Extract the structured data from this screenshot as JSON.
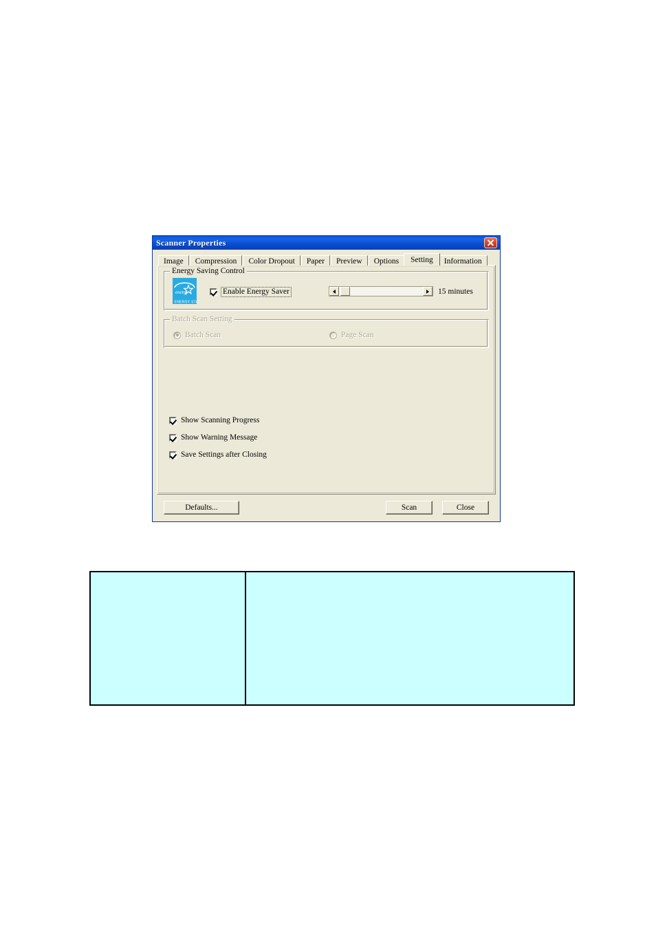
{
  "dialog": {
    "title": "Scanner Properties",
    "close_icon": "close-icon",
    "tabs": [
      {
        "label": "Image",
        "active": false
      },
      {
        "label": "Compression",
        "active": false
      },
      {
        "label": "Color Dropout",
        "active": false
      },
      {
        "label": "Paper",
        "active": false
      },
      {
        "label": "Preview",
        "active": false
      },
      {
        "label": "Options",
        "active": false
      },
      {
        "label": "Setting",
        "active": true
      },
      {
        "label": "Information",
        "active": false
      }
    ],
    "energy_group": {
      "title": "Energy Saving Control",
      "logo_alt": "ENERGY STAR",
      "logo_word": "energy",
      "logo_caption": "ENERGY STAR",
      "enable_checkbox": {
        "label": "Enable Energy Saver",
        "checked": true,
        "focused": true
      },
      "slider": {
        "value_label": "15 minutes",
        "left_arrow_icon": "arrow-left-icon",
        "right_arrow_icon": "arrow-right-icon",
        "thumb_position_percent": 2
      }
    },
    "batch_group": {
      "title": "Batch Scan Setting",
      "disabled": true,
      "options": [
        {
          "label": "Batch Scan",
          "selected": true
        },
        {
          "label": "Page Scan",
          "selected": false
        }
      ]
    },
    "options_checkboxes": [
      {
        "label": "Show Scanning Progress",
        "checked": true
      },
      {
        "label": "Show Warning Message",
        "checked": true
      },
      {
        "label": "Save Settings after Closing",
        "checked": true
      }
    ],
    "buttons": {
      "defaults": "Defaults...",
      "scan": "Scan",
      "close": "Close"
    }
  },
  "info_table": {
    "rows": 1,
    "columns": 2,
    "cells": [
      "",
      ""
    ],
    "fill_color": "#ccffff",
    "border_color": "#000000"
  },
  "colors": {
    "titlebar_blue": "#0d5ce0",
    "dialog_face": "#ece9d8",
    "close_red": "#d9472c",
    "energy_star_blue": "#29abe2",
    "table_cyan": "#ccffff"
  }
}
